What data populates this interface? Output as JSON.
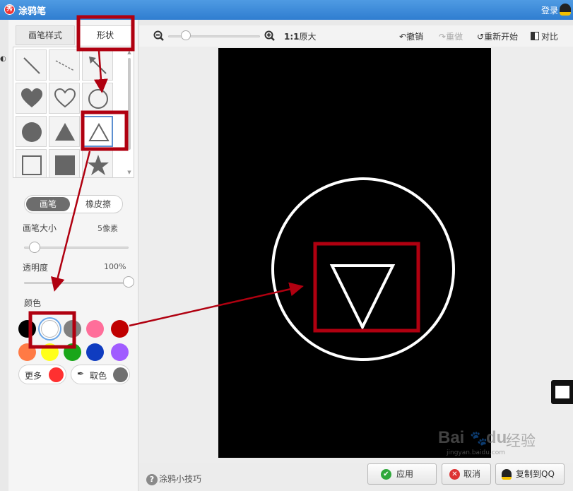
{
  "window": {
    "title": "涂鸦笔",
    "logo_text": "秀",
    "login": "登录"
  },
  "tabs": {
    "brush_style": "画笔样式",
    "shape": "形状"
  },
  "shapes": [
    "line",
    "dashed-line",
    "arrow",
    "heart-filled",
    "heart-outline",
    "circle-outline",
    "circle-filled",
    "triangle-filled",
    "triangle-outline",
    "square-outline",
    "square-filled",
    "star-filled"
  ],
  "selected_shape": "triangle-outline",
  "mode": {
    "pen": "画笔",
    "eraser": "橡皮擦"
  },
  "brush_size": {
    "label": "画笔大小",
    "value": "5像素",
    "level": 0.05
  },
  "opacity": {
    "label": "透明度",
    "value": "100%",
    "level": 1.0
  },
  "colors": {
    "label": "颜色",
    "row1": [
      "#000000",
      "#ffffff",
      "#808080",
      "#ff6e9a",
      "#c00000"
    ],
    "row2": [
      "#ff7a45",
      "#ffff1a",
      "#19a619",
      "#0f3cc0",
      "#a05cff"
    ],
    "selected": "#ffffff",
    "more_label": "更多",
    "more_color": "#ff3030",
    "pick_label": "取色",
    "pick_color": "#707070"
  },
  "toolbar": {
    "zoom_ratio": "1:1",
    "original_size": "原大",
    "undo": "撤销",
    "redo": "重做",
    "restart": "重新开始",
    "compare": "对比",
    "zoom_level": 0.15
  },
  "bottom": {
    "tips": "涂鸦小技巧",
    "apply": "应用",
    "cancel": "取消",
    "copy_qq": "复制到QQ"
  },
  "watermark": {
    "brand": "Bai",
    "brand2": "du",
    "suffix": "经验",
    "url": "jingyan.baidu.com"
  },
  "annotation_color": "#b00010"
}
